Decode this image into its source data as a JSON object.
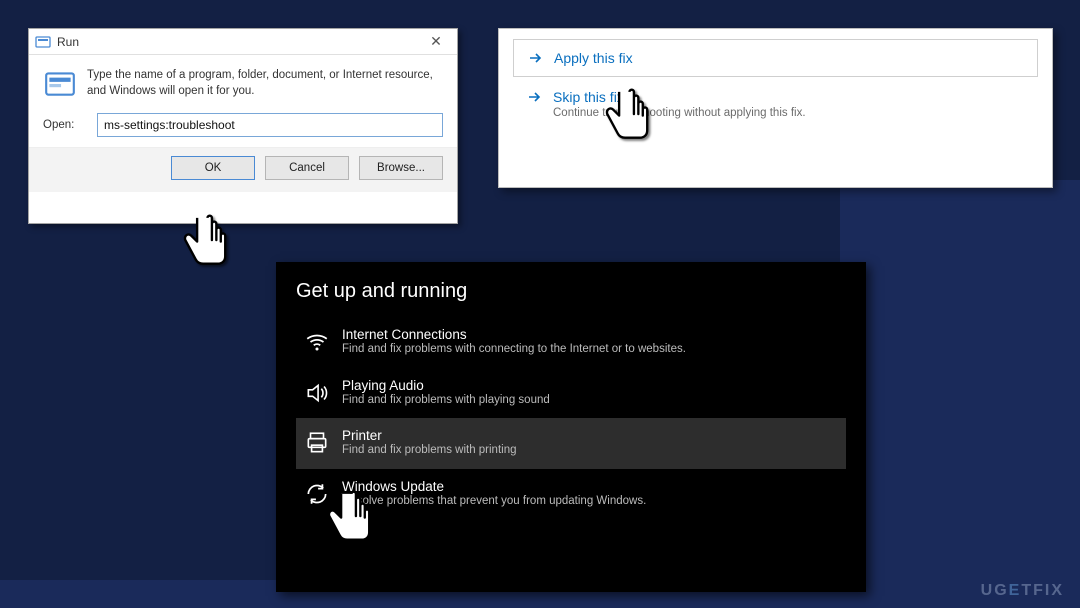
{
  "runDialog": {
    "title": "Run",
    "description": "Type the name of a program, folder, document, or Internet resource, and Windows will open it for you.",
    "openLabel": "Open:",
    "inputValue": "ms-settings:troubleshoot",
    "buttons": {
      "ok": "OK",
      "cancel": "Cancel",
      "browse": "Browse..."
    }
  },
  "fixPanel": {
    "apply": "Apply this fix",
    "skip": "Skip this fix",
    "skipSub": "Continue troubleshooting without applying this fix."
  },
  "troubleshoot": {
    "heading": "Get up and running",
    "items": [
      {
        "title": "Internet Connections",
        "sub": "Find and fix problems with connecting to the Internet or to websites."
      },
      {
        "title": "Playing Audio",
        "sub": "Find and fix problems with playing sound"
      },
      {
        "title": "Printer",
        "sub": "Find and fix problems with printing"
      },
      {
        "title": "Windows Update",
        "sub": "Resolve problems that prevent you from updating Windows."
      }
    ]
  },
  "watermark": {
    "a": "UG",
    "b": "E",
    "c": "TFIX"
  }
}
